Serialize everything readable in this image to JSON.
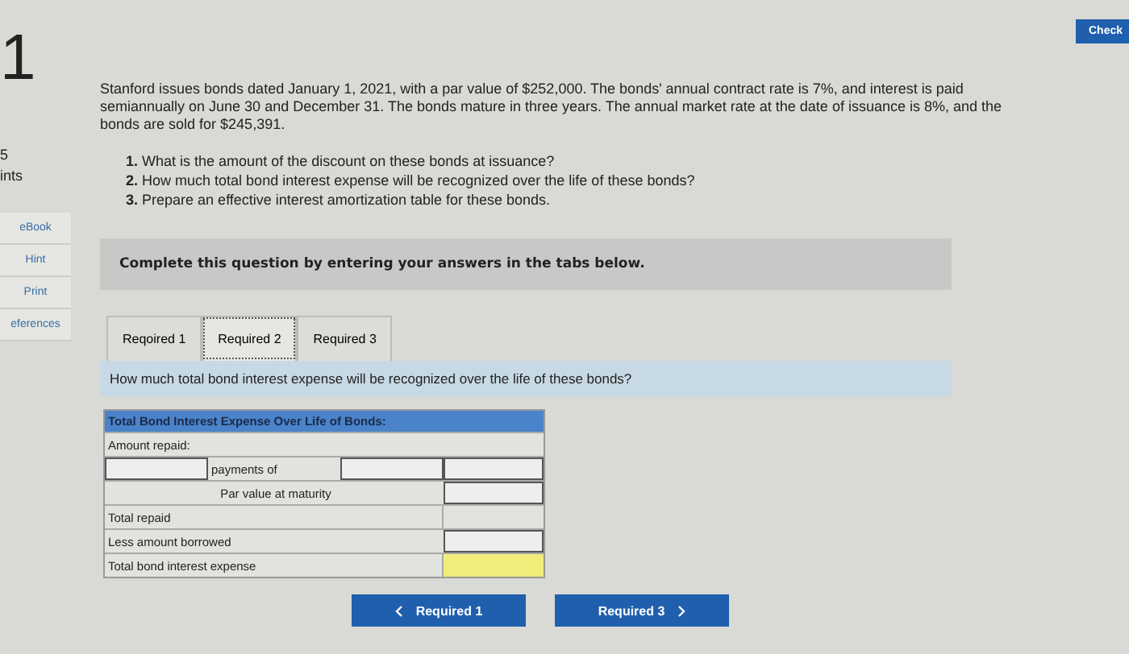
{
  "sidebar": {
    "question_number": "1",
    "points_value": "5",
    "points_label": "ints",
    "links": [
      "eBook",
      "Hint",
      "Print",
      "eferences"
    ]
  },
  "check_button": "Check",
  "problem": "Stanford issues bonds dated January 1, 2021, with a par value of $252,000. The bonds' annual contract rate is 7%, and interest is paid semiannually on June 30 and December 31. The bonds mature in three years. The annual market rate at the date of issuance is 8%, and the bonds are sold for $245,391.",
  "questions": [
    {
      "number": "1.",
      "text": "What is the amount of the discount on these bonds at issuance?"
    },
    {
      "number": "2.",
      "text": "How much total bond interest expense will be recognized over the life of these bonds?"
    },
    {
      "number": "3.",
      "text": "Prepare an effective interest amortization table for these bonds."
    }
  ],
  "instruction": "Complete this question by entering your answers in the tabs below.",
  "tabs": [
    {
      "label": "Reqoired 1",
      "selected": false
    },
    {
      "label": "Required 2",
      "selected": true
    },
    {
      "label": "Required 3",
      "selected": false
    }
  ],
  "prompt": "How much total bond interest expense will be recognized over the life of these bonds?",
  "table": {
    "title": "Total Bond Interest Expense Over Life of Bonds:",
    "rows": [
      {
        "kind": "label",
        "label": "Amount repaid:"
      },
      {
        "kind": "payments",
        "label": "payments of"
      },
      {
        "kind": "centered",
        "label": "Par value at maturity",
        "input": true
      },
      {
        "kind": "line",
        "label": "Total repaid",
        "input": false
      },
      {
        "kind": "line",
        "label": "Less amount borrowed",
        "input": true
      },
      {
        "kind": "line",
        "label": "Total bond interest expense",
        "input": false,
        "highlighted": true
      }
    ]
  },
  "nav": {
    "previous": "Required 1",
    "next": "Required 3"
  }
}
